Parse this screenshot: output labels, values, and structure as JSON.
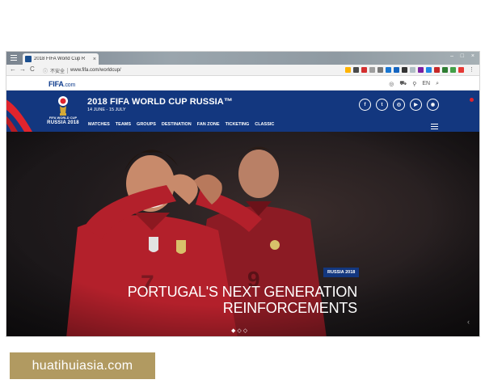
{
  "browser": {
    "tab_title": "2018 FIFA World Cup R",
    "tab_close": "×",
    "minimize": "–",
    "maximize": "□",
    "close": "×",
    "back": "←",
    "forward": "→",
    "reload": "C",
    "home": "⌂",
    "security_label": "不安全",
    "url": "www.fifa.com/worldcup/",
    "more": "⋮",
    "extension_colors": [
      "#ffb300",
      "#4a4a4a",
      "#d32f2f",
      "#9e9e9e",
      "#777777",
      "#1976d2",
      "#1565c0",
      "#333333",
      "#b0bec5",
      "#7b1fa2",
      "#1e88e5",
      "#c62828",
      "#2e7d32",
      "#43a047",
      "#e53935"
    ]
  },
  "fifa_bar": {
    "logo": "FIFA",
    "logo_suffix": ".com",
    "language": "EN"
  },
  "wc_header": {
    "title": "2018 FIFA WORLD CUP RUSSIA™",
    "dates": "14 JUNE - 15 JULY",
    "emblem_line1": "FIFA WORLD CUP",
    "emblem_line2": "RUSSIA 2018",
    "nav": [
      "MATCHES",
      "TEAMS",
      "GROUPS",
      "DESTINATION",
      "FAN ZONE",
      "TICKETING",
      "CLASSIC"
    ],
    "social": [
      "f",
      "t",
      "◎",
      "▶",
      "◉"
    ],
    "brand_color": "#13377f",
    "accent_color": "#e0242d"
  },
  "hero": {
    "badge": "RUSSIA 2018",
    "headline_line1": "PORTUGAL'S NEXT GENERATION",
    "headline_line2": "REINFORCEMENTS",
    "dots": "◆◇◇",
    "next": "‹"
  },
  "caption": {
    "text": "huatihuiasia.com",
    "color": "#b19a61"
  }
}
